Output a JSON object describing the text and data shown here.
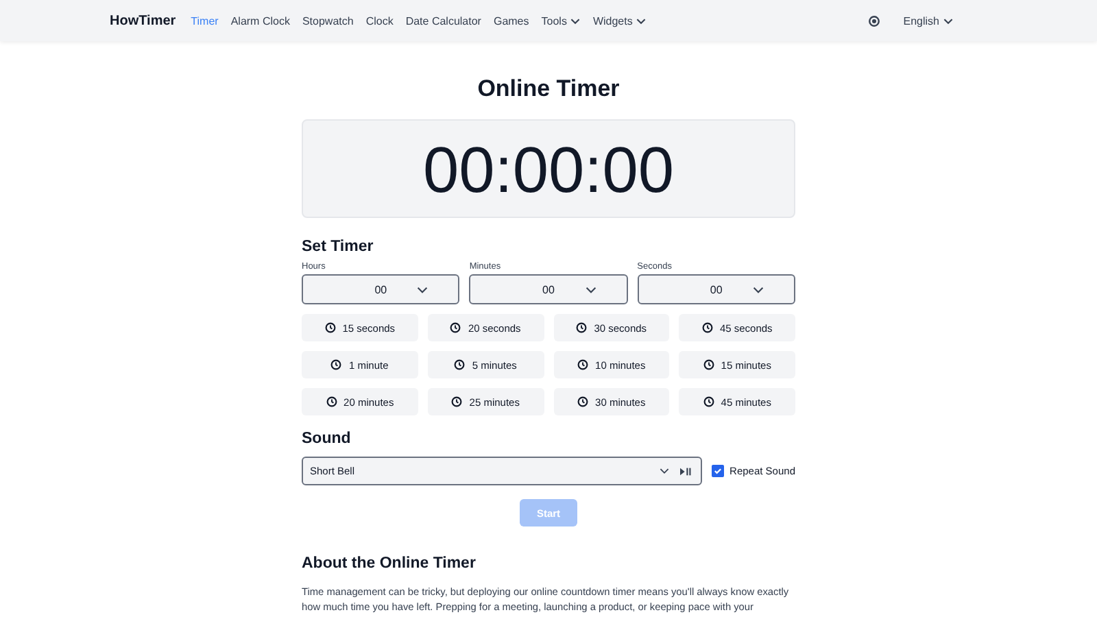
{
  "brand": "HowTimer",
  "nav": [
    {
      "label": "Timer",
      "selected": true,
      "dropdown": false
    },
    {
      "label": "Alarm Clock",
      "selected": false,
      "dropdown": false
    },
    {
      "label": "Stopwatch",
      "selected": false,
      "dropdown": false
    },
    {
      "label": "Clock",
      "selected": false,
      "dropdown": false
    },
    {
      "label": "Date Calculator",
      "selected": false,
      "dropdown": false
    },
    {
      "label": "Games",
      "selected": false,
      "dropdown": false
    },
    {
      "label": "Tools",
      "selected": false,
      "dropdown": true
    },
    {
      "label": "Widgets",
      "selected": false,
      "dropdown": true
    }
  ],
  "language": "English",
  "title": "Online Timer",
  "display": "00:00:00",
  "set_timer": {
    "heading": "Set Timer",
    "fields": [
      {
        "label": "Hours",
        "value": "00"
      },
      {
        "label": "Minutes",
        "value": "00"
      },
      {
        "label": "Seconds",
        "value": "00"
      }
    ]
  },
  "presets": [
    "15 seconds",
    "20 seconds",
    "30 seconds",
    "45 seconds",
    "1 minute",
    "5 minutes",
    "10 minutes",
    "15 minutes",
    "20 minutes",
    "25 minutes",
    "30 minutes",
    "45 minutes"
  ],
  "sound": {
    "heading": "Sound",
    "value": "Short Bell",
    "repeat": {
      "label": "Repeat Sound",
      "checked": true
    }
  },
  "start": {
    "label": "Start",
    "disabled": true
  },
  "about": {
    "heading": "About the Online Timer",
    "text": "Time management can be tricky, but deploying our online countdown timer means you'll always know exactly how much time you have left. Prepping for a meeting, launching a product, or keeping pace with your"
  }
}
